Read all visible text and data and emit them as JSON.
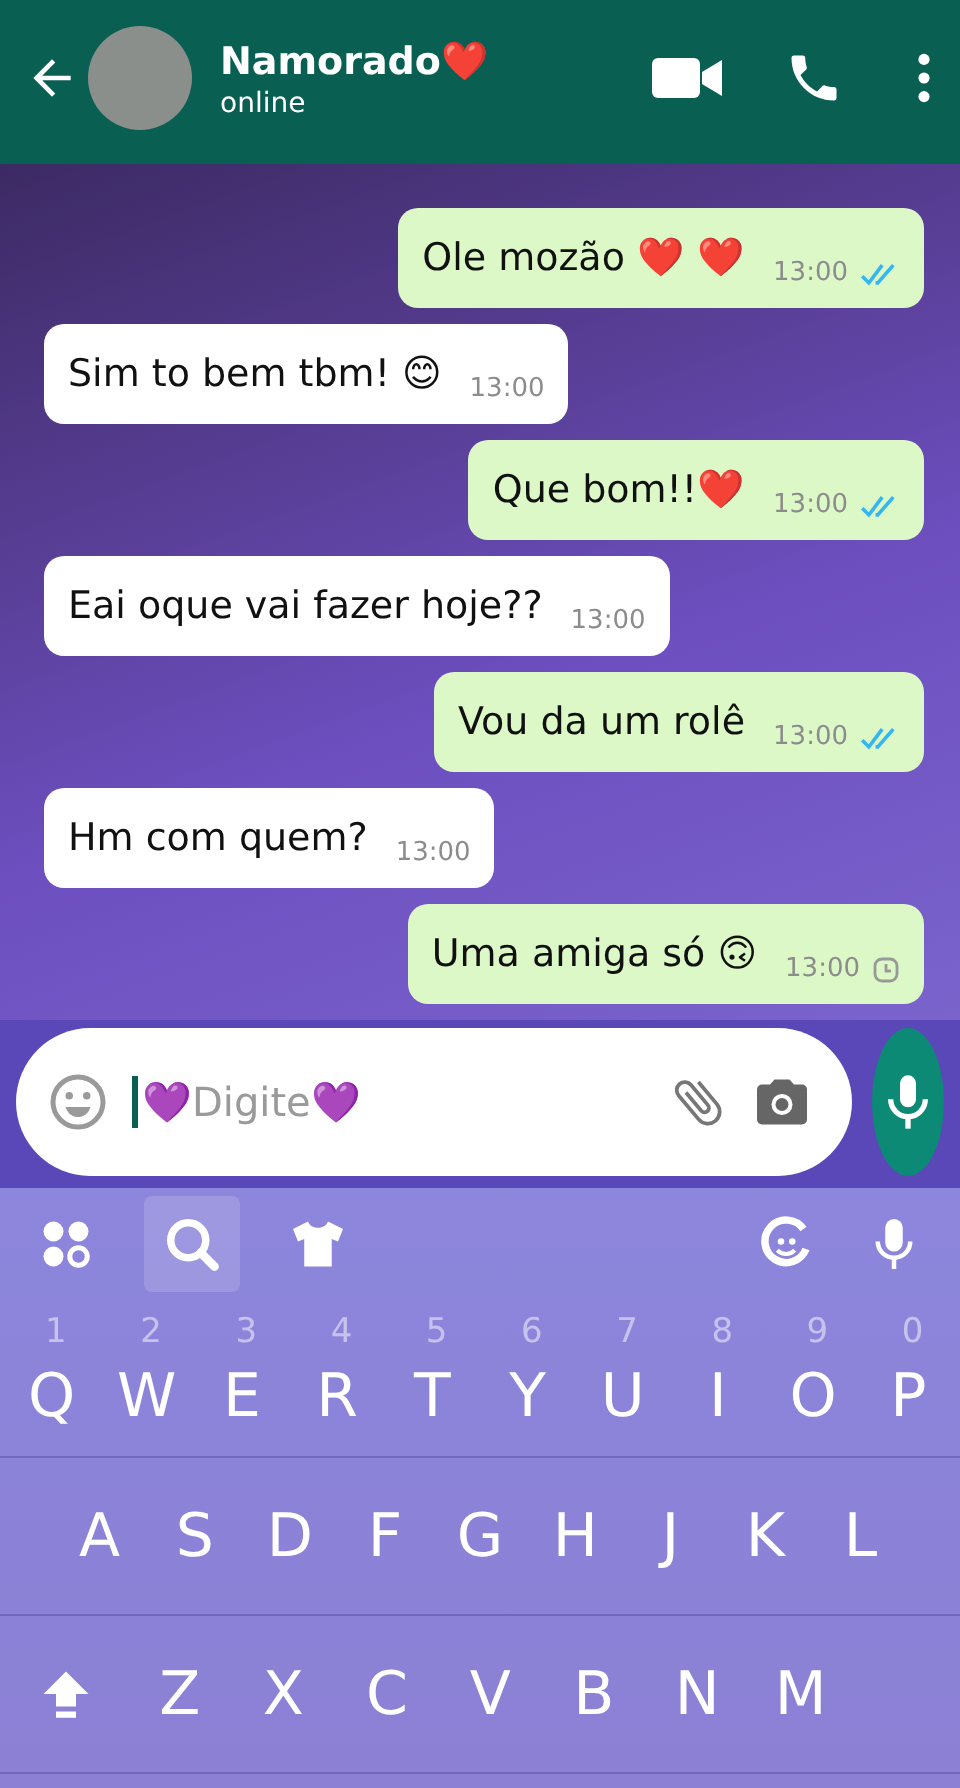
{
  "header": {
    "contact_name": "Namorado❤️",
    "status": "online"
  },
  "messages": [
    {
      "outgoing": true,
      "text": "Ole mozão ❤️ ❤️",
      "time": "13:00",
      "read": true
    },
    {
      "outgoing": false,
      "text": "Sim to bem tbm! 😊",
      "time": "13:00"
    },
    {
      "outgoing": true,
      "text": "Que bom!!❤️",
      "time": "13:00",
      "read": true
    },
    {
      "outgoing": false,
      "text": "Eai oque vai fazer hoje??",
      "time": "13:00"
    },
    {
      "outgoing": true,
      "text": "Vou da um rolê",
      "time": "13:00",
      "read": true
    },
    {
      "outgoing": false,
      "text": "Hm com quem?",
      "time": "13:00"
    },
    {
      "outgoing": true,
      "text": "Uma amiga só 🙃",
      "time": "13:00",
      "read": false
    }
  ],
  "composer": {
    "placeholder": "💜Digite💜"
  },
  "keyboard": {
    "rows": [
      {
        "keys": [
          {
            "label": "Q",
            "hint": "1"
          },
          {
            "label": "W",
            "hint": "2"
          },
          {
            "label": "E",
            "hint": "3"
          },
          {
            "label": "R",
            "hint": "4"
          },
          {
            "label": "T",
            "hint": "5"
          },
          {
            "label": "Y",
            "hint": "6"
          },
          {
            "label": "U",
            "hint": "7"
          },
          {
            "label": "I",
            "hint": "8"
          },
          {
            "label": "O",
            "hint": "9"
          },
          {
            "label": "P",
            "hint": "0"
          }
        ]
      },
      {
        "keys": [
          {
            "label": "A"
          },
          {
            "label": "S"
          },
          {
            "label": "D"
          },
          {
            "label": "F"
          },
          {
            "label": "G"
          },
          {
            "label": "H"
          },
          {
            "label": "J"
          },
          {
            "label": "K"
          },
          {
            "label": "L"
          }
        ]
      },
      {
        "shift": true,
        "keys": [
          {
            "label": "Z"
          },
          {
            "label": "X"
          },
          {
            "label": "C"
          },
          {
            "label": "V"
          },
          {
            "label": "B"
          },
          {
            "label": "N"
          },
          {
            "label": "M"
          }
        ]
      }
    ]
  }
}
